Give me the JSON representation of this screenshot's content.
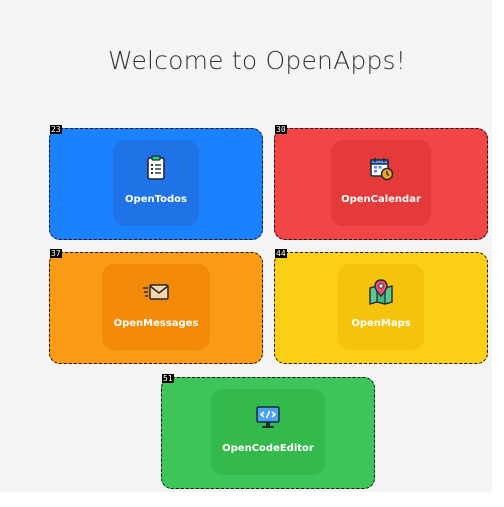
{
  "page": {
    "title": "Welcome to OpenApps!"
  },
  "apps": [
    {
      "id": "23",
      "name": "OpenTodos",
      "icon": "clipboard-list-icon",
      "color": "#1a82ff",
      "inner_color": "#1f73e6"
    },
    {
      "id": "30",
      "name": "OpenCalendar",
      "icon": "calendar-clock-icon",
      "color": "#f24545",
      "inner_color": "#e53a3a"
    },
    {
      "id": "37",
      "name": "OpenMessages",
      "icon": "envelope-fast-icon",
      "color": "#fb9a14",
      "inner_color": "#f48a0a"
    },
    {
      "id": "44",
      "name": "OpenMaps",
      "icon": "map-pin-icon",
      "color": "#fccf17",
      "inner_color": "#f5c20c"
    },
    {
      "id": "51",
      "name": "OpenCodeEditor",
      "icon": "code-monitor-icon",
      "color": "#3ec559",
      "inner_color": "#34b94d"
    }
  ]
}
